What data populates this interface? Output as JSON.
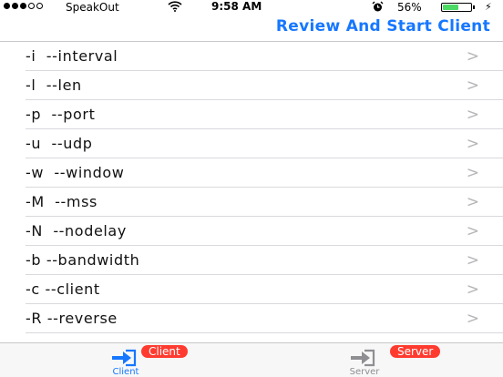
{
  "status_bar": {
    "carrier": "SpeakOut",
    "time": "9:58 AM",
    "battery_percent_label": "56%",
    "battery_level": 0.56,
    "signal_bars_filled": 3,
    "signal_bars_total": 5
  },
  "nav_bar": {
    "action_label": "Review And Start Client"
  },
  "options": [
    {
      "label": "-i  --interval"
    },
    {
      "label": "-l  --len"
    },
    {
      "label": "-p  --port"
    },
    {
      "label": "-u  --udp"
    },
    {
      "label": "-w  --window"
    },
    {
      "label": "-M  --mss"
    },
    {
      "label": "-N  --nodelay"
    },
    {
      "label": "-b --bandwidth"
    },
    {
      "label": "-c --client"
    },
    {
      "label": "-R --reverse"
    }
  ],
  "chevron_glyph": ">",
  "tabs": [
    {
      "label": "Client",
      "badge": "Client",
      "icon": "sign-in-icon",
      "selected": true
    },
    {
      "label": "Server",
      "badge": "Server",
      "icon": "sign-in-icon",
      "selected": false
    }
  ],
  "colors": {
    "accent": "#1677ff",
    "badge": "#ff3b30",
    "battery": "#4cd964"
  }
}
